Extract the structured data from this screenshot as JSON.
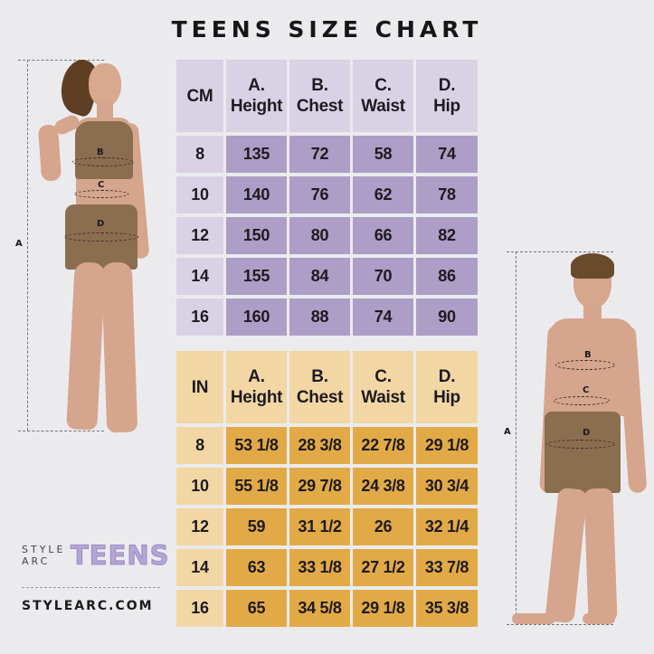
{
  "title": "TEENS SIZE CHART",
  "cm_table": {
    "unit": "CM",
    "headers": [
      {
        "letter": "A.",
        "name": "Height"
      },
      {
        "letter": "B.",
        "name": "Chest"
      },
      {
        "letter": "C.",
        "name": "Waist"
      },
      {
        "letter": "D.",
        "name": "Hip"
      }
    ],
    "rows": [
      {
        "size": "8",
        "values": [
          "135",
          "72",
          "58",
          "74"
        ]
      },
      {
        "size": "10",
        "values": [
          "140",
          "76",
          "62",
          "78"
        ]
      },
      {
        "size": "12",
        "values": [
          "150",
          "80",
          "66",
          "82"
        ]
      },
      {
        "size": "14",
        "values": [
          "155",
          "84",
          "70",
          "86"
        ]
      },
      {
        "size": "16",
        "values": [
          "160",
          "88",
          "74",
          "90"
        ]
      }
    ]
  },
  "in_table": {
    "unit": "IN",
    "headers": [
      {
        "letter": "A.",
        "name": "Height"
      },
      {
        "letter": "B.",
        "name": "Chest"
      },
      {
        "letter": "C.",
        "name": "Waist"
      },
      {
        "letter": "D.",
        "name": "Hip"
      }
    ],
    "rows": [
      {
        "size": "8",
        "values": [
          "53 1/8",
          "28 3/8",
          "22 7/8",
          "29 1/8"
        ]
      },
      {
        "size": "10",
        "values": [
          "55 1/8",
          "29 7/8",
          "24 3/8",
          "30 3/4"
        ]
      },
      {
        "size": "12",
        "values": [
          "59",
          "31 1/2",
          "26",
          "32 1/4"
        ]
      },
      {
        "size": "14",
        "values": [
          "63",
          "33 1/8",
          "27 1/2",
          "33 7/8"
        ]
      },
      {
        "size": "16",
        "values": [
          "65",
          "34 5/8",
          "29 1/8",
          "35 3/8"
        ]
      }
    ]
  },
  "figures": {
    "girl": {
      "height_label": "A",
      "markers": [
        "B",
        "C",
        "D"
      ]
    },
    "boy": {
      "height_label": "A",
      "markers": [
        "B",
        "C",
        "D"
      ]
    }
  },
  "brand": {
    "logo_small": "STYLE ARC",
    "logo_big": "TEENS",
    "website": "STYLEARC.COM"
  },
  "colors": {
    "cm_header": "#d9d2e5",
    "cm_value": "#ac9ec6",
    "in_header": "#f2d7a4",
    "in_value": "#e2aa47",
    "background": "#ebebed",
    "logo_teens": "#b3a6d4"
  }
}
